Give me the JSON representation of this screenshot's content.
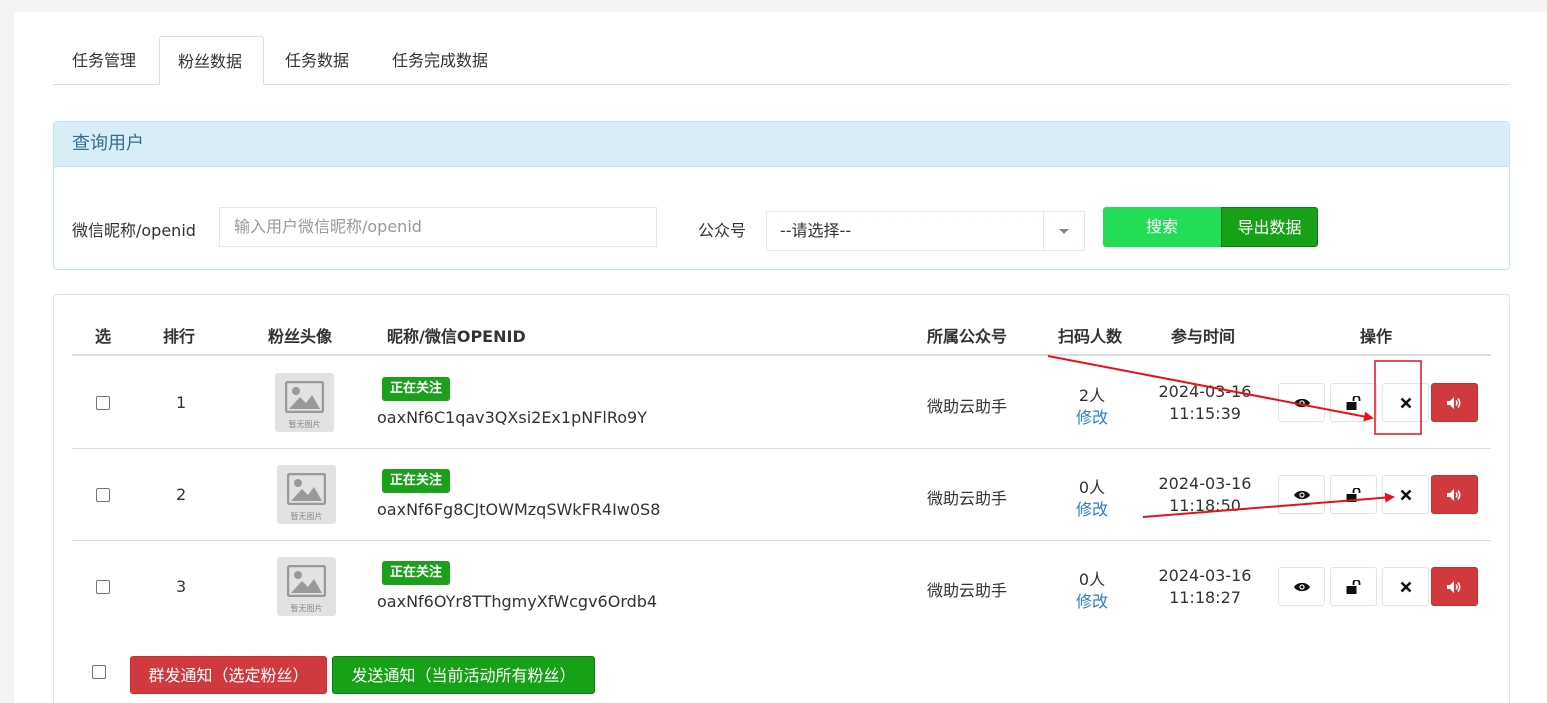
{
  "tabs": [
    {
      "label": "任务管理"
    },
    {
      "label": "粉丝数据"
    },
    {
      "label": "任务数据"
    },
    {
      "label": "任务完成数据"
    }
  ],
  "search_panel": {
    "title": "查询用户",
    "nickname_label": "微信昵称/openid",
    "nickname_placeholder": "输入用户微信昵称/openid",
    "account_label": "公众号",
    "account_selected": "--请选择--",
    "search_button": "搜索",
    "export_button": "导出数据"
  },
  "table": {
    "headers": {
      "select": "选",
      "rank": "排行",
      "avatar": "粉丝头像",
      "nickname": "昵称/微信OPENID",
      "account": "所属公众号",
      "scans": "扫码人数",
      "joined": "参与时间",
      "actions": "操作"
    },
    "avatar_placeholder_text": "暂无图片",
    "edit_link": "修改",
    "rows": [
      {
        "rank": "1",
        "status": "正在关注",
        "openid": "oaxNf6C1qav3QXsi2Ex1pNFlRo9Y",
        "account": "微助云助手",
        "scans": "2人",
        "date": "2024-03-16",
        "time": "11:15:39"
      },
      {
        "rank": "2",
        "status": "正在关注",
        "openid": "oaxNf6Fg8CJtOWMzqSWkFR4Iw0S8",
        "account": "微助云助手",
        "scans": "0人",
        "date": "2024-03-16",
        "time": "11:18:50"
      },
      {
        "rank": "3",
        "status": "正在关注",
        "openid": "oaxNf6OYr8TThgmyXfWcgv6Ordb4",
        "account": "微助云助手",
        "scans": "0人",
        "date": "2024-03-16",
        "time": "11:18:27"
      }
    ]
  },
  "footer": {
    "group_notify_button": "群发通知（选定粉丝）",
    "send_all_button": "发送通知（当前活动所有粉丝）"
  },
  "colors": {
    "green_button": "#22dd55",
    "dark_green_button": "#16a116",
    "badge_green": "#1c9f1b",
    "red_button": "#d0393e",
    "panel_header": "#d9edf7",
    "link_blue": "#2a7ec7",
    "annotation_red": "#e8111a"
  },
  "icons": {
    "view": "eye-icon",
    "unlock": "unlock-icon",
    "delete": "close-icon",
    "notify": "volume-icon"
  }
}
